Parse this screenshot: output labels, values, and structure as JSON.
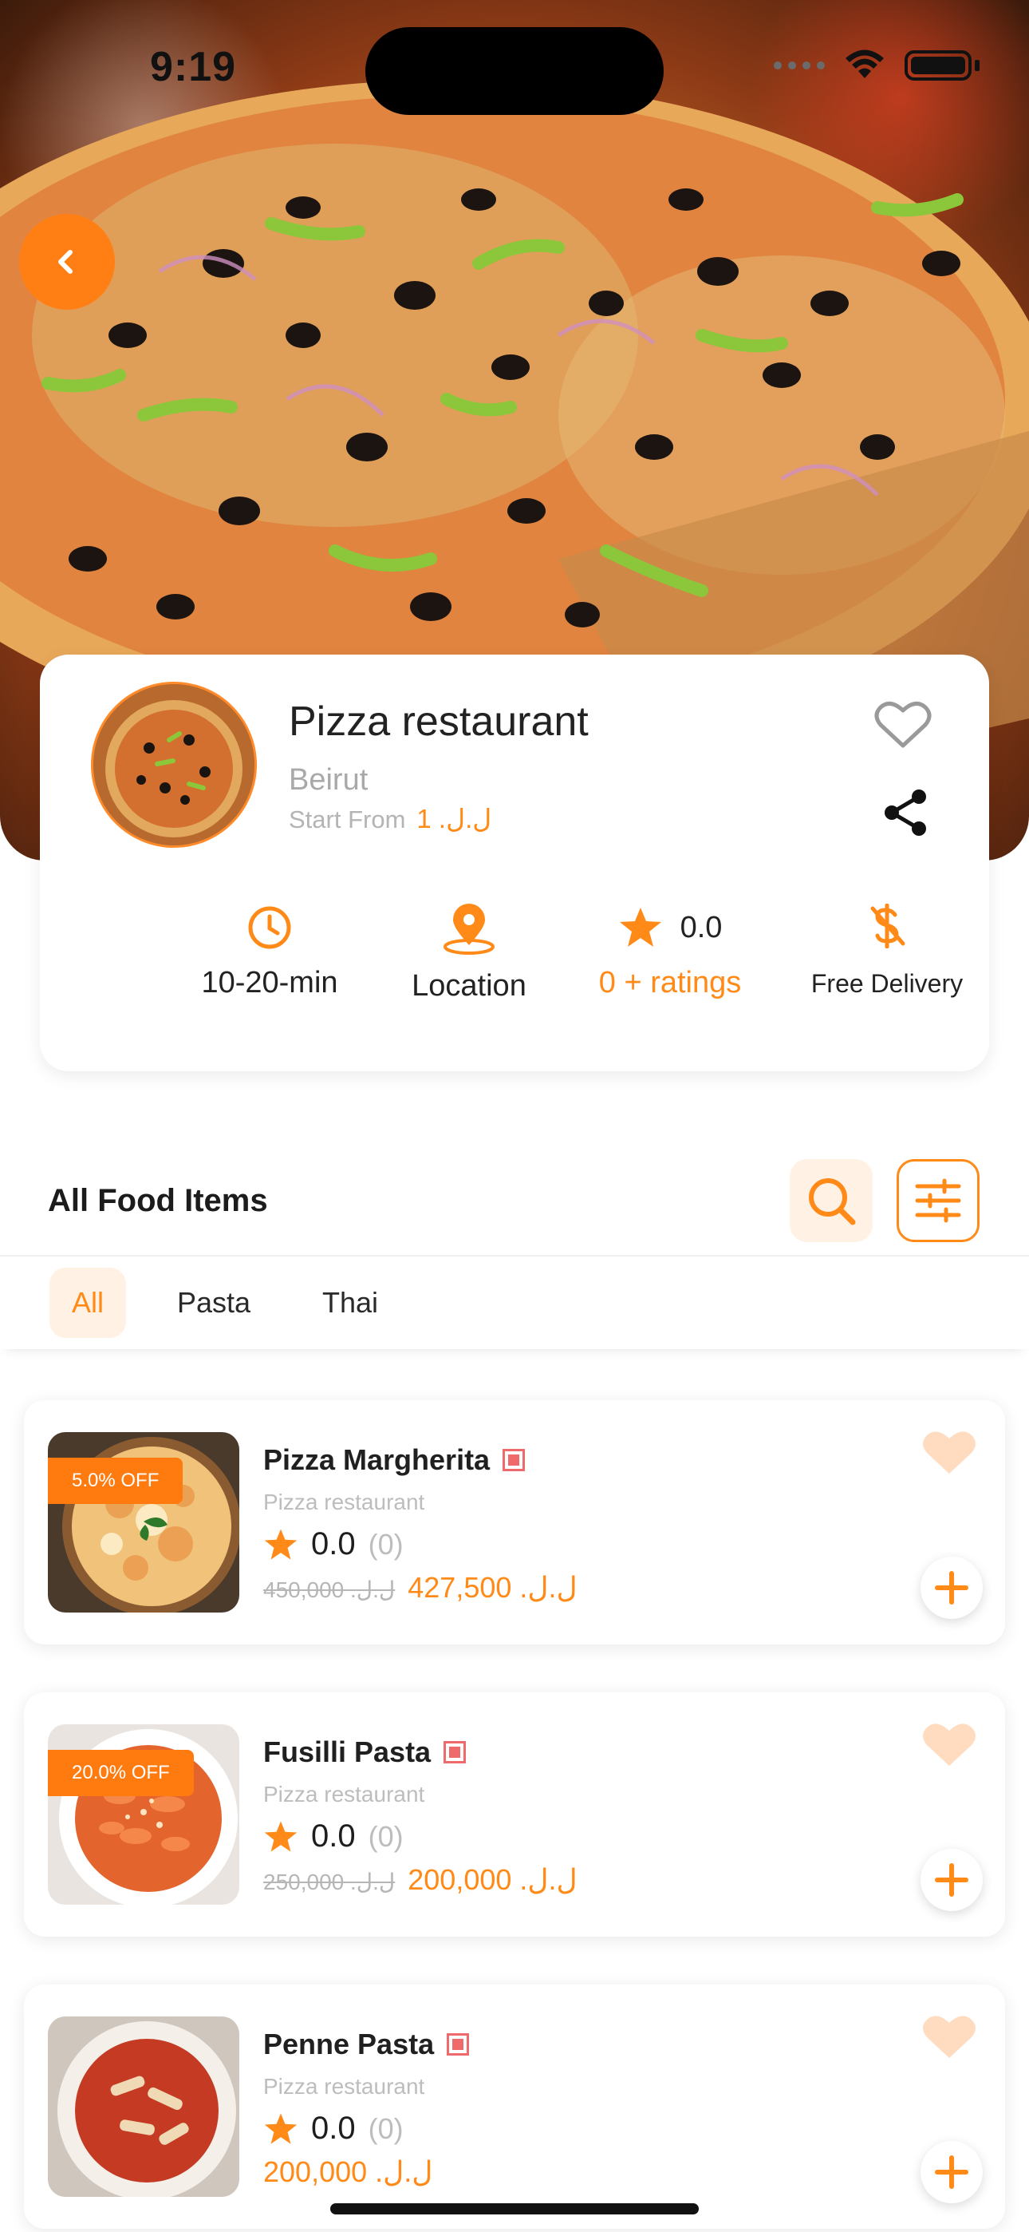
{
  "status_bar": {
    "time": "9:19"
  },
  "restaurant": {
    "name": "Pizza restaurant",
    "city": "Beirut",
    "start_from_label": "Start From",
    "start_from_price": "1 .ل.ل"
  },
  "stats": {
    "time": "10-20-min",
    "location": "Location",
    "rating": "0.0",
    "ratings_count": "0 + ratings",
    "delivery": "Free Delivery"
  },
  "section": {
    "title": "All Food Items"
  },
  "tabs": [
    {
      "label": "All",
      "active": true
    },
    {
      "label": "Pasta",
      "active": false
    },
    {
      "label": "Thai",
      "active": false
    }
  ],
  "items": [
    {
      "name": "Pizza Margherita",
      "restaurant": "Pizza restaurant",
      "discount": "5.0% OFF",
      "rating": "0.0",
      "rating_count": "(0)",
      "old_price": "450,000 .ل.ل",
      "price": "427,500 .ل.ل"
    },
    {
      "name": "Fusilli Pasta",
      "restaurant": "Pizza restaurant",
      "discount": "20.0% OFF",
      "rating": "0.0",
      "rating_count": "(0)",
      "old_price": "250,000 .ل.ل",
      "price": "200,000 .ل.ل"
    },
    {
      "name": "Penne Pasta",
      "restaurant": "Pizza restaurant",
      "rating": "0.0",
      "rating_count": "(0)",
      "price": "200,000 .ل.ل"
    }
  ],
  "colors": {
    "accent": "#ff8a17",
    "accent_light": "#fff1e4",
    "veg_marker": "#ef6b6b",
    "heart_fav": "#ffdcbf"
  },
  "icons": [
    "back-chevron-icon",
    "heart-outline-icon",
    "share-icon",
    "clock-icon",
    "location-pin-icon",
    "star-icon",
    "free-delivery-icon",
    "search-icon",
    "filter-sliders-icon",
    "veg-marker-icon",
    "heart-icon",
    "plus-icon"
  ]
}
